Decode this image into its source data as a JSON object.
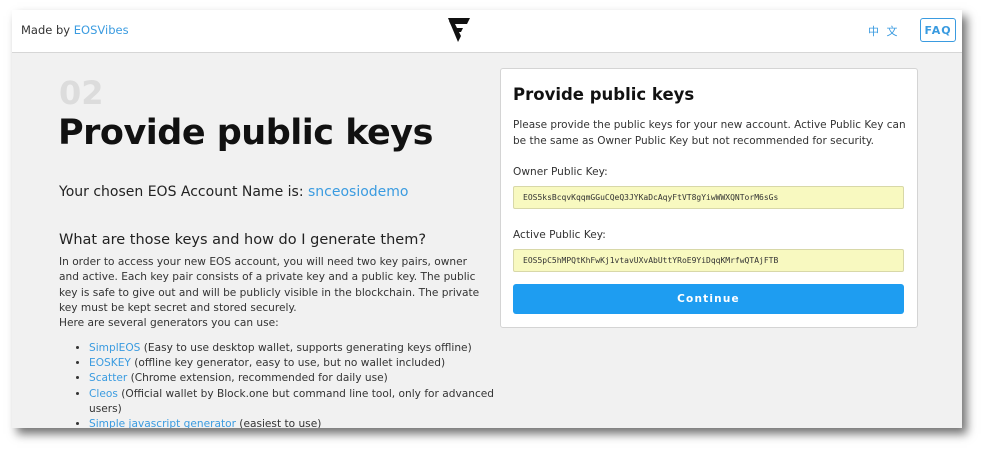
{
  "header": {
    "made_by_prefix": "Made by",
    "made_by_link": "EOSVibes",
    "language": "中 文",
    "faq_label": "FAQ"
  },
  "main": {
    "step_number": "02",
    "title": "Provide public keys",
    "account_prefix": "Your chosen EOS Account Name is:",
    "account_name": "snceosiodemo",
    "section_heading": "What are those keys and how do I generate them?",
    "intro_paragraph": "In order to access your new EOS account, you will need two key pairs, owner and active. Each key pair consists of a private key and a public key. The public key is safe to give out and will be publicly visible in the blockchain. The private key must be kept secret and stored securely.",
    "generators_intro": "Here are several generators you can use:",
    "generators": [
      {
        "link": "SimplEOS",
        "text": " (Easy to use desktop wallet, supports generating keys offline)"
      },
      {
        "link": "EOSKEY",
        "text": " (offline key generator, easy to use, but no wallet included)"
      },
      {
        "link": "Scatter",
        "text": " (Chrome extension, recommended for daily use)"
      },
      {
        "link": "Cleos",
        "text": " (Official wallet by Block.one but command line tool, only for advanced users)"
      },
      {
        "link": "Simple javascript generator",
        "text": " (easiest to use)"
      }
    ]
  },
  "panel": {
    "title": "Provide public keys",
    "description": "Please provide the public keys for your new account. Active Public Key can be the same as Owner Public Key but not recommended for security.",
    "owner_label": "Owner Public Key:",
    "owner_value": "EOS5ksBcqvKqqmGGuCQeQ3JYKaDcAqyFtVT8gYiwWWXQNTorM6sGs",
    "active_label": "Active Public Key:",
    "active_value": "EOS5pC5hMPQtKhFwKj1vtavUXvAbUttYRoE9YiDqqKMrfwQTAjFTB",
    "continue_label": "Continue"
  },
  "colors": {
    "accent": "#3a9be0",
    "button": "#1e9df1",
    "key_field_bg": "#f8f9c0",
    "background": "#f1f1f1"
  },
  "icons": {
    "logo": "eosvibes-logo-icon"
  }
}
